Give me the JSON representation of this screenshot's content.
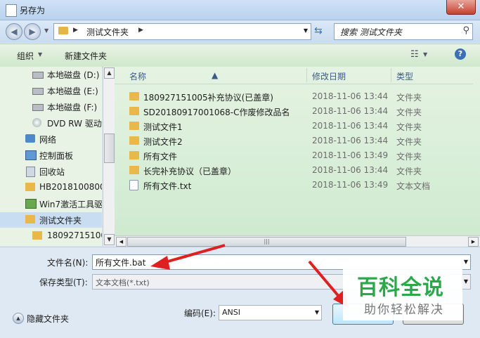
{
  "window": {
    "title": "另存为",
    "close_label": "✕"
  },
  "nav": {
    "back_icon": "◀",
    "forward_icon": "▶",
    "path_segments": [
      "测试文件夹"
    ],
    "search_placeholder": "搜索 测试文件夹"
  },
  "toolbar": {
    "organize_label": "组织",
    "new_folder_label": "新建文件夹"
  },
  "sidebar": {
    "items": [
      {
        "label": "本地磁盘 (D:)",
        "icon": "drive-icon",
        "indent": 2,
        "selected": false
      },
      {
        "label": "本地磁盘 (E:)",
        "icon": "drive-icon",
        "indent": 2,
        "selected": false
      },
      {
        "label": "本地磁盘 (F:)",
        "icon": "drive-icon",
        "indent": 2,
        "selected": false
      },
      {
        "label": "DVD RW 驱动",
        "icon": "dvd-icon",
        "indent": 2,
        "selected": false
      },
      {
        "label": "网络",
        "icon": "network-icon",
        "indent": 1,
        "selected": false
      },
      {
        "label": "控制面板",
        "icon": "control-panel-icon",
        "indent": 1,
        "selected": false
      },
      {
        "label": "回收站",
        "icon": "recycle-bin-icon",
        "indent": 1,
        "selected": false
      },
      {
        "label": "HB2018100800",
        "icon": "folder-icon",
        "indent": 1,
        "selected": false
      },
      {
        "label": "Win7激活工具驱",
        "icon": "app-icon",
        "indent": 1,
        "selected": false
      },
      {
        "label": "测试文件夹",
        "icon": "folder-icon",
        "indent": 1,
        "selected": true
      },
      {
        "label": "18092715100",
        "icon": "folder-icon",
        "indent": 2,
        "selected": false
      }
    ]
  },
  "files": {
    "columns": {
      "name": "名称",
      "date": "修改日期",
      "type": "类型"
    },
    "rows": [
      {
        "name": "180927151005补充协议(已盖章)",
        "date": "2018-11-06 13:44",
        "type": "文件夹",
        "kind": "folder"
      },
      {
        "name": "SD20180917001068-C作废修改品名",
        "date": "2018-11-06 13:44",
        "type": "文件夹",
        "kind": "folder"
      },
      {
        "name": "测试文件1",
        "date": "2018-11-06 13:44",
        "type": "文件夹",
        "kind": "folder"
      },
      {
        "name": "测试文件2",
        "date": "2018-11-06 13:44",
        "type": "文件夹",
        "kind": "folder"
      },
      {
        "name": "所有文件",
        "date": "2018-11-06 13:49",
        "type": "文件夹",
        "kind": "folder"
      },
      {
        "name": "长完补充协议（已盖章）",
        "date": "2018-11-06 13:44",
        "type": "文件夹",
        "kind": "folder"
      },
      {
        "name": "所有文件.txt",
        "date": "2018-11-06 13:49",
        "type": "文本文档",
        "kind": "text"
      }
    ]
  },
  "form": {
    "filename_label": "文件名(N):",
    "filename_value": "所有文件.bat",
    "savetype_label": "保存类型(T):",
    "savetype_value": "文本文档(*.txt)",
    "encoding_label": "编码(E):",
    "encoding_value": "ANSI",
    "hide_folders_label": "隐藏文件夹"
  },
  "watermark": {
    "title": "百科全说",
    "subtitle": "助你轻松解决"
  },
  "colors": {
    "annotation_arrow": "#e02020",
    "watermark_green": "#2aa84a"
  }
}
